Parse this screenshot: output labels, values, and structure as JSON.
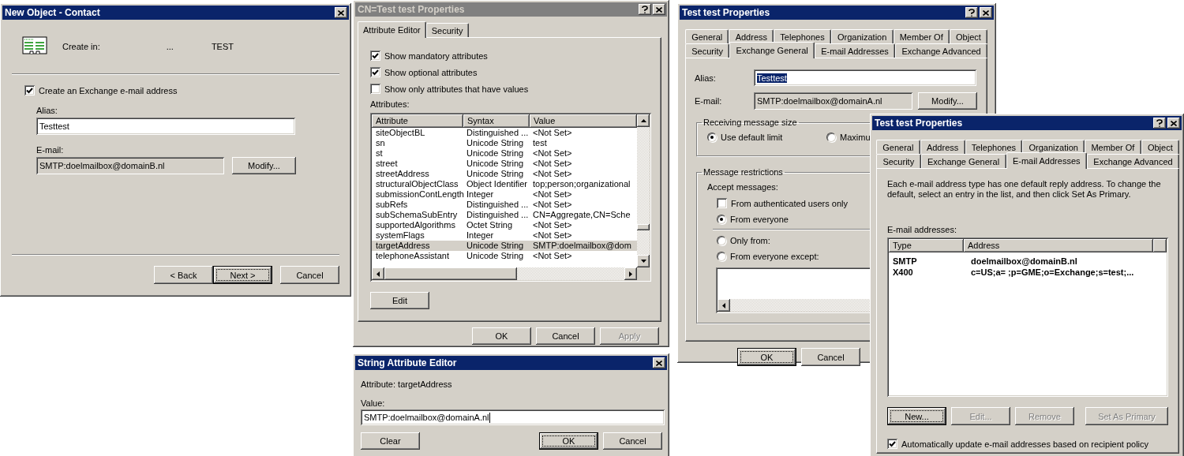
{
  "new_contact": {
    "title": "New Object - Contact",
    "active": true,
    "create_in_label": "Create in:",
    "create_in_path": "...",
    "create_in_container": "TEST",
    "create_exchange": {
      "label": "Create an Exchange e-mail address",
      "checked": true
    },
    "alias": {
      "label": "Alias:",
      "value": "Testtest"
    },
    "email": {
      "label": "E-mail:",
      "value": "SMTP:doelmailbox@domainB.nl",
      "button": "Modify..."
    },
    "buttons": [
      {
        "label": "< Back",
        "default": false
      },
      {
        "label": "Next >",
        "default": true
      },
      {
        "label": "Cancel",
        "default": false
      }
    ]
  },
  "attribute_editor": {
    "title": "CN=Test test Properties",
    "active": false,
    "tabs": [
      {
        "label": "Attribute Editor",
        "selected": true
      },
      {
        "label": "Security",
        "selected": false
      }
    ],
    "options": [
      {
        "label": "Show mandatory attributes",
        "checked": true
      },
      {
        "label": "Show optional attributes",
        "checked": true
      },
      {
        "label": "Show only attributes that have values",
        "checked": false
      }
    ],
    "attributes_label": "Attributes:",
    "columns": [
      "Attribute",
      "Syntax",
      "Value"
    ],
    "rows": [
      {
        "cells": [
          "siteObjectBL",
          "Distinguished ...",
          "<Not Set>"
        ],
        "selected": false
      },
      {
        "cells": [
          "sn",
          "Unicode String",
          "test"
        ],
        "selected": false
      },
      {
        "cells": [
          "st",
          "Unicode String",
          "<Not Set>"
        ],
        "selected": false
      },
      {
        "cells": [
          "street",
          "Unicode String",
          "<Not Set>"
        ],
        "selected": false
      },
      {
        "cells": [
          "streetAddress",
          "Unicode String",
          "<Not Set>"
        ],
        "selected": false
      },
      {
        "cells": [
          "structuralObjectClass",
          "Object Identifier",
          "top;person;organizational"
        ],
        "selected": false
      },
      {
        "cells": [
          "submissionContLength",
          "Integer",
          "<Not Set>"
        ],
        "selected": false
      },
      {
        "cells": [
          "subRefs",
          "Distinguished ...",
          "<Not Set>"
        ],
        "selected": false
      },
      {
        "cells": [
          "subSchemaSubEntry",
          "Distinguished ...",
          "CN=Aggregate,CN=Sche"
        ],
        "selected": false
      },
      {
        "cells": [
          "supportedAlgorithms",
          "Octet String",
          "<Not Set>"
        ],
        "selected": false
      },
      {
        "cells": [
          "systemFlags",
          "Integer",
          "<Not Set>"
        ],
        "selected": false
      },
      {
        "cells": [
          "targetAddress",
          "Unicode String",
          "SMTP:doelmailbox@dom"
        ],
        "selected": true
      },
      {
        "cells": [
          "telephoneAssistant",
          "Unicode String",
          "<Not Set>"
        ],
        "selected": false
      }
    ],
    "edit_button": "Edit",
    "buttons": [
      {
        "label": "OK",
        "disabled": false
      },
      {
        "label": "Cancel",
        "disabled": false
      },
      {
        "label": "Apply",
        "disabled": true
      }
    ]
  },
  "string_editor": {
    "title": "String Attribute Editor",
    "active": true,
    "attribute_label": "Attribute: targetAddress",
    "value_label": "Value:",
    "value": "SMTP:doelmailbox@domainA.nl",
    "clear_button": "Clear",
    "buttons": [
      {
        "label": "OK",
        "default": true
      },
      {
        "label": "Cancel",
        "default": false
      }
    ]
  },
  "exchange_general": {
    "title": "Test test Properties",
    "active": true,
    "tab_rows": [
      {
        "tabs": [
          {
            "label": "General",
            "selected": false
          },
          {
            "label": "Address",
            "selected": false
          },
          {
            "label": "Telephones",
            "selected": false
          },
          {
            "label": "Organization",
            "selected": false
          },
          {
            "label": "Member Of",
            "selected": false
          },
          {
            "label": "Object",
            "selected": false
          }
        ]
      },
      {
        "tabs": [
          {
            "label": "Security",
            "selected": false
          },
          {
            "label": "Exchange General",
            "selected": true
          },
          {
            "label": "E-mail Addresses",
            "selected": false
          },
          {
            "label": "Exchange Advanced",
            "selected": false
          }
        ]
      }
    ],
    "alias": {
      "label": "Alias:",
      "value": "Testtest",
      "value_selected": true
    },
    "email": {
      "label": "E-mail:",
      "value": "SMTP:doelmailbox@domainA.nl",
      "button": "Modify..."
    },
    "size_group": {
      "label": "Receiving message size",
      "options": [
        {
          "label": "Use default limit",
          "selected": true
        },
        {
          "label": "Maximu",
          "selected": false
        }
      ]
    },
    "restrictions_group": {
      "label": "Message restrictions",
      "accept_label": "Accept messages:",
      "authenticated_only": {
        "label": "From authenticated users only",
        "checked": false
      },
      "accept_options": [
        {
          "label": "From everyone",
          "selected": true
        },
        {
          "label": "Only from:",
          "selected": false
        },
        {
          "label": "From everyone except:",
          "selected": false
        }
      ]
    },
    "buttons": [
      {
        "label": "OK",
        "default": true
      },
      {
        "label": "Cancel",
        "default": false
      }
    ]
  },
  "email_addresses": {
    "title": "Test test Properties",
    "active": true,
    "tab_rows": [
      {
        "tabs": [
          {
            "label": "General",
            "selected": false
          },
          {
            "label": "Address",
            "selected": false
          },
          {
            "label": "Telephones",
            "selected": false
          },
          {
            "label": "Organization",
            "selected": false
          },
          {
            "label": "Member Of",
            "selected": false
          },
          {
            "label": "Object",
            "selected": false
          }
        ]
      },
      {
        "tabs": [
          {
            "label": "Security",
            "selected": false
          },
          {
            "label": "Exchange General",
            "selected": false
          },
          {
            "label": "E-mail Addresses",
            "selected": true
          },
          {
            "label": "Exchange Advanced",
            "selected": false
          }
        ]
      }
    ],
    "description": "Each e-mail address type has one default reply address. To change the default, select an entry in the list, and then click Set As Primary.",
    "list_label": "E-mail addresses:",
    "columns": [
      "Type",
      "Address"
    ],
    "rows": [
      {
        "type": "SMTP",
        "address": "doelmailbox@domainB.nl",
        "primary": true
      },
      {
        "type": "X400",
        "address": "c=US;a= ;p=GME;o=Exchange;s=test;...",
        "primary": true
      }
    ],
    "buttons": [
      {
        "label": "New...",
        "default": true,
        "disabled": false
      },
      {
        "label": "Edit...",
        "default": false,
        "disabled": true
      },
      {
        "label": "Remove",
        "default": false,
        "disabled": true
      },
      {
        "label": "Set As Primary",
        "default": false,
        "disabled": true
      }
    ],
    "auto_update": {
      "label": "Automatically update e-mail addresses based on recipient policy",
      "checked": true
    }
  }
}
